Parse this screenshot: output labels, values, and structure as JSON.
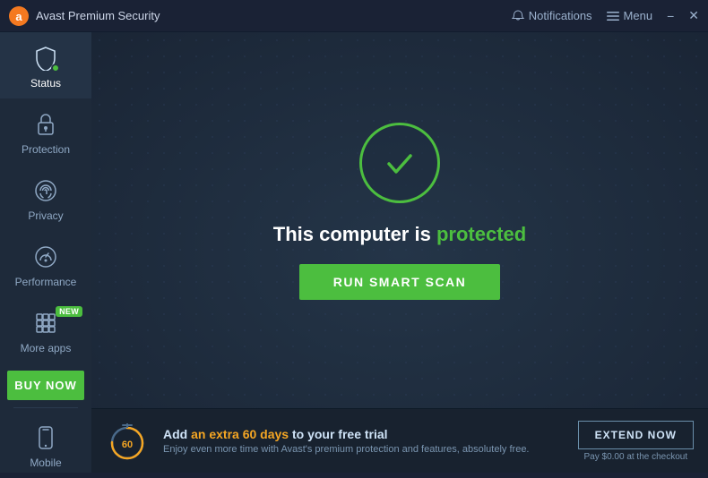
{
  "titlebar": {
    "logo_alt": "Avast logo",
    "title": "Avast Premium Security",
    "notifications_label": "Notifications",
    "menu_label": "Menu",
    "minimize_label": "−",
    "close_label": "✕"
  },
  "sidebar": {
    "items": [
      {
        "id": "status",
        "label": "Status",
        "active": true,
        "badge": null
      },
      {
        "id": "protection",
        "label": "Protection",
        "active": false,
        "badge": null
      },
      {
        "id": "privacy",
        "label": "Privacy",
        "active": false,
        "badge": null
      },
      {
        "id": "performance",
        "label": "Performance",
        "active": false,
        "badge": null
      },
      {
        "id": "more-apps",
        "label": "More apps",
        "active": false,
        "badge": "NEW"
      }
    ],
    "buy_now_label": "BUY NOW",
    "mobile_label": "Mobile"
  },
  "main": {
    "protected_text_prefix": "This computer is ",
    "protected_text_green": "protected",
    "scan_button_label": "RUN SMART SCAN"
  },
  "banner": {
    "title_prefix": "Add ",
    "title_highlight": "an extra 60 days",
    "title_suffix": " to your free trial",
    "subtitle": "Enjoy even more time with Avast's premium protection and features, absolutely free.",
    "extend_button_label": "EXTEND NOW",
    "extend_sub": "Pay $0.00 at the checkout"
  },
  "colors": {
    "green": "#4cbe3f",
    "orange": "#f5a623",
    "accent": "#4cbe3f"
  }
}
